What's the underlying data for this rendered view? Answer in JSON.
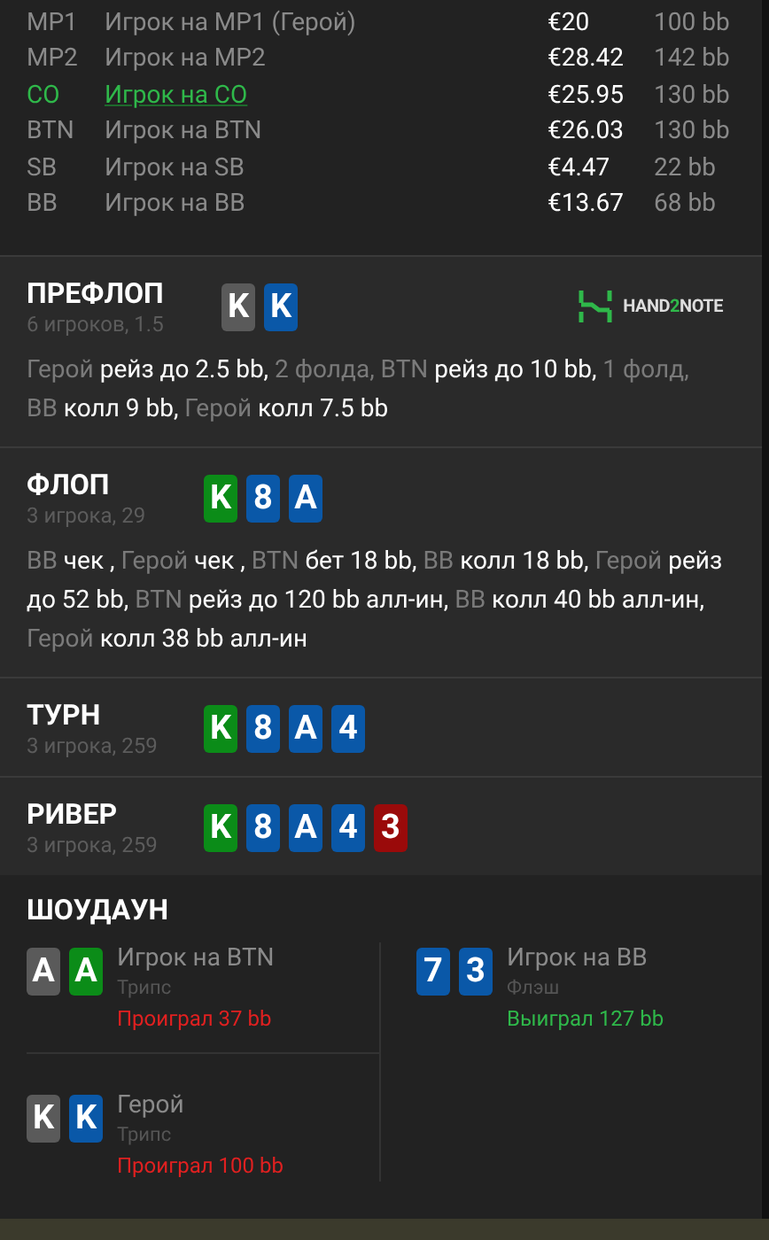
{
  "players": [
    {
      "position": "MP1",
      "name": "Игрок на MP1 (Герой)",
      "stack": "€20",
      "bb": "100 bb",
      "selected": false
    },
    {
      "position": "MP2",
      "name": "Игрок на MP2",
      "stack": "€28.42",
      "bb": "142 bb",
      "selected": false
    },
    {
      "position": "CO",
      "name": "Игрок на CO",
      "stack": "€25.95",
      "bb": "130 bb",
      "selected": true
    },
    {
      "position": "BTN",
      "name": "Игрок на BTN",
      "stack": "€26.03",
      "bb": "130 bb",
      "selected": false
    },
    {
      "position": "SB",
      "name": "Игрок на SB",
      "stack": "€4.47",
      "bb": "22 bb",
      "selected": false
    },
    {
      "position": "BB",
      "name": "Игрок на BB",
      "stack": "€13.67",
      "bb": "68 bb",
      "selected": false
    }
  ],
  "streets": [
    {
      "title": "ПРЕФЛОП",
      "info": "6 игроков, 1.5",
      "logo": {
        "text_a": "HAND",
        "text_b": "2",
        "text_c": "NOTE"
      },
      "cards": [
        {
          "rank": "K",
          "color": "#5a5a5a"
        },
        {
          "rank": "K",
          "color": "#0a58a8"
        }
      ],
      "actions": "Герой **рейз до 2.5 bb,** 2 фолда, BTN **рейз до 10 bb,** 1 фолд, BB **колл 9 bb,** Герой **колл 7.5 bb**"
    },
    {
      "title": "ФЛОП",
      "info": "3 игрока, 29",
      "cards": [
        {
          "rank": "K",
          "color": "#0b8c18"
        },
        {
          "rank": "8",
          "color": "#0a58a8"
        },
        {
          "rank": "A",
          "color": "#0a58a8"
        }
      ],
      "actions": "BB **чек ,** Герой **чек ,** BTN **бет 18 bb,** BB **колл 18 bb,** Герой **рейз до 52 bb,** BTN **рейз до 120 bb алл-ин,** BB **колл 40 bb алл-ин,** Герой **колл 38 bb алл-ин**"
    },
    {
      "title": "ТУРН",
      "info": "3 игрока, 259",
      "cards": [
        {
          "rank": "K",
          "color": "#0b8c18"
        },
        {
          "rank": "8",
          "color": "#0a58a8"
        },
        {
          "rank": "A",
          "color": "#0a58a8"
        },
        {
          "rank": "4",
          "color": "#0a58a8"
        }
      ]
    },
    {
      "title": "РИВЕР",
      "info": "3 игрока, 259",
      "cards": [
        {
          "rank": "K",
          "color": "#0b8c18"
        },
        {
          "rank": "8",
          "color": "#0a58a8"
        },
        {
          "rank": "A",
          "color": "#0a58a8"
        },
        {
          "rank": "4",
          "color": "#0a58a8"
        },
        {
          "rank": "3",
          "color": "#9a0a0a"
        }
      ]
    }
  ],
  "showdown": {
    "title": "ШОУДАУН",
    "hands": [
      {
        "player": "Игрок на BTN",
        "combo": "Трипс",
        "result": "Проиграл 37 bb",
        "kind": "lose",
        "cards": [
          {
            "rank": "A",
            "color": "#5a5a5a"
          },
          {
            "rank": "A",
            "color": "#0b8c18"
          }
        ]
      },
      {
        "player": "Игрок на BB",
        "combo": "Флэш",
        "result": "Выиграл 127 bb",
        "kind": "win",
        "cards": [
          {
            "rank": "7",
            "color": "#0a58a8"
          },
          {
            "rank": "3",
            "color": "#0a58a8"
          }
        ]
      },
      {
        "player": "Герой",
        "combo": "Трипс",
        "result": "Проиграл 100 bb",
        "kind": "lose",
        "cards": [
          {
            "rank": "K",
            "color": "#5a5a5a"
          },
          {
            "rank": "K",
            "color": "#0a58a8"
          }
        ]
      }
    ]
  }
}
